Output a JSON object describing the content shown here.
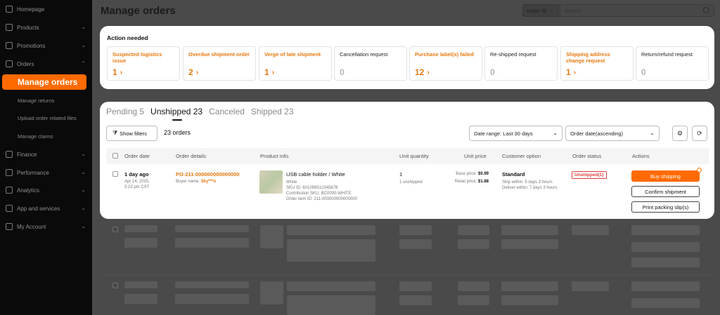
{
  "sidebar": {
    "items": [
      {
        "label": "Homepage",
        "icon": "home-icon"
      },
      {
        "label": "Products",
        "icon": "box-icon"
      },
      {
        "label": "Promotions",
        "icon": "tag-icon"
      },
      {
        "label": "Orders",
        "icon": "orders-icon"
      },
      {
        "label": "Finance",
        "icon": "dollar-icon"
      },
      {
        "label": "Performance",
        "icon": "gauge-icon"
      },
      {
        "label": "Analytics",
        "icon": "chart-icon"
      },
      {
        "label": "App and services",
        "icon": "apps-icon"
      },
      {
        "label": "My Account",
        "icon": "user-icon"
      }
    ],
    "orders_sub": [
      "Manage orders",
      "Manage returns",
      "Upload order related files",
      "Manage claims"
    ]
  },
  "header": {
    "title": "Manage orders",
    "search_type": "Order ID",
    "search_placeholder": "Search"
  },
  "action_needed": {
    "title": "Action needed",
    "tiles": [
      {
        "label": "Suspected logistics issue",
        "count": "1",
        "style": "orange"
      },
      {
        "label": "Overdue shipment order",
        "count": "2",
        "style": "orange"
      },
      {
        "label": "Verge of late shipment",
        "count": "1",
        "style": "orange"
      },
      {
        "label": "Cancellation request",
        "count": "0",
        "style": "gray"
      },
      {
        "label": "Purchase label(s) failed",
        "count": "12",
        "style": "orange"
      },
      {
        "label": "Re-shipped request",
        "count": "0",
        "style": "gray"
      },
      {
        "label": "Shipping address change request",
        "count": "1",
        "style": "orange"
      },
      {
        "label": "Return/refund request",
        "count": "0",
        "style": "gray"
      }
    ]
  },
  "orders": {
    "tabs": [
      {
        "label": "Pending 5",
        "active": false
      },
      {
        "label": "Unshipped 23",
        "active": true
      },
      {
        "label": "Canceled",
        "active": false
      },
      {
        "label": "Shipped 23",
        "active": false
      }
    ],
    "show_filters": "Show filters",
    "count_label": "23 orders",
    "date_range": "Date range: Last 30 days",
    "sort": "Order date(ascending)",
    "columns": [
      "Order date",
      "Order details",
      "Product info.",
      "Unit quantity",
      "Unit price",
      "Customer option",
      "Order status",
      "Actions"
    ],
    "row": {
      "age": "1 day ago",
      "date": "Apr 14, 2025,",
      "time": "5:23 pm CST",
      "order_id": "PO-211-000000000000000",
      "buyer_label": "Buyer name:",
      "buyer_name": "Sky***o",
      "product_name": "USB cable holder / White",
      "variant": "White",
      "sku": "SKU ID: 601099512345678",
      "contribution_sku": "Contribution SKU: BC0000-WHITE",
      "order_item_id": "Order item ID: 211-000000000000000",
      "quantity": "1",
      "quantity_note": "1 unshipped",
      "base_price_label": "Base price:",
      "base_price": "$0.99",
      "retail_price_label": "Retail price:",
      "retail_price": "$1.88",
      "customer_option": "Standard",
      "ship_within": "Ship within: 5 days 3 hours",
      "deliver_within": "Deliver within: 7 days 3 hours",
      "status": "Unshipped(1)",
      "action_primary": "Buy shipping",
      "action_confirm": "Confirm shipment",
      "action_print": "Print packing slip(s)"
    }
  }
}
